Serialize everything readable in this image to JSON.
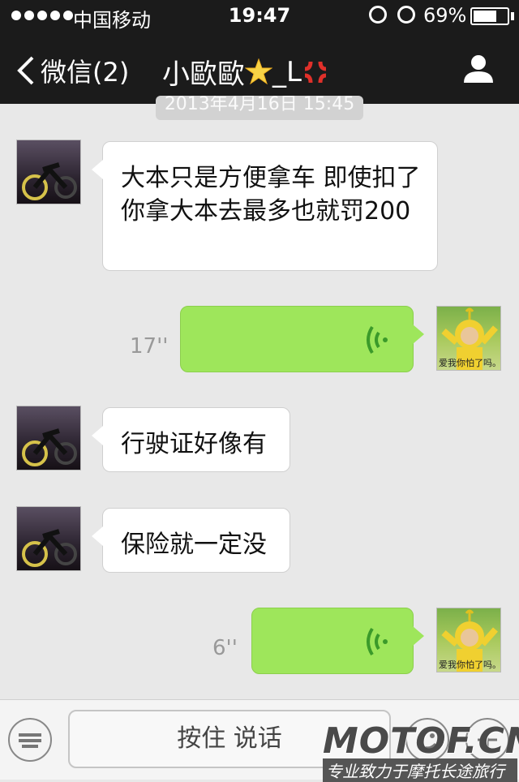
{
  "status_bar": {
    "carrier": "中国移动",
    "time": "19:47",
    "battery": "69%",
    "battery_level": 0.69
  },
  "nav": {
    "back_label": "微信(2)",
    "title": "小歐歐",
    "title_suffix": "_L"
  },
  "timestamp": "2013年4月16日 15:45",
  "messages": [
    {
      "side": "left",
      "type": "text",
      "text": "大本只是方便拿车 即使扣了 你拿大本去最多也就罚200"
    },
    {
      "side": "right",
      "type": "voice",
      "duration": "17''"
    },
    {
      "side": "left",
      "type": "text",
      "text": "行驶证好像有"
    },
    {
      "side": "left",
      "type": "text",
      "text": "保险就一定没"
    },
    {
      "side": "right",
      "type": "voice",
      "duration": "6''"
    }
  ],
  "avatar_caption": "爱我你怕了吗。",
  "input": {
    "hold_to_talk": "按住 说话"
  },
  "watermark": {
    "logo": "MOTOF.CN",
    "tagline": "专业致力于摩托长途旅行"
  },
  "colors": {
    "bar": "#1b1b1b",
    "chat_bg": "#e8e8e8",
    "outgoing": "#9ee65b",
    "incoming": "#ffffff"
  }
}
